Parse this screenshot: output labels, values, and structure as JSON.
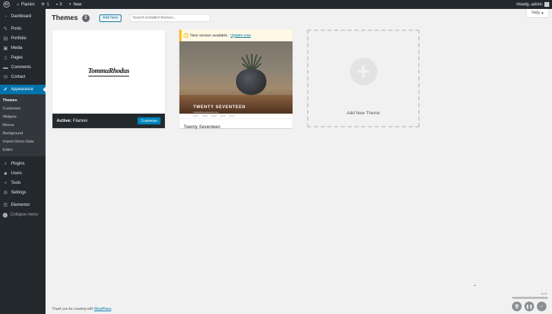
{
  "admin_bar": {
    "site_name": "Flamini",
    "updates_count": "1",
    "comments_count": "0",
    "new_label": "New",
    "howdy": "Howdy, admin"
  },
  "sidebar": {
    "items": [
      {
        "label": "Dashboard",
        "icon": "dashboard-icon"
      },
      {
        "label": "Posts",
        "icon": "pin-icon"
      },
      {
        "label": "Portfolio",
        "icon": "portfolio-icon"
      },
      {
        "label": "Media",
        "icon": "media-icon"
      },
      {
        "label": "Pages",
        "icon": "pages-icon"
      },
      {
        "label": "Comments",
        "icon": "comment-icon"
      },
      {
        "label": "Contact",
        "icon": "mail-icon"
      },
      {
        "label": "Appearance",
        "icon": "paintbrush-icon"
      }
    ],
    "appearance_submenu": [
      "Themes",
      "Customize",
      "Widgets",
      "Menus",
      "Background",
      "Import Demo Data",
      "Editor"
    ],
    "items_after": [
      {
        "label": "Plugins",
        "icon": "plugin-icon"
      },
      {
        "label": "Users",
        "icon": "users-icon"
      },
      {
        "label": "Tools",
        "icon": "wrench-icon"
      },
      {
        "label": "Settings",
        "icon": "settings-icon"
      },
      {
        "label": "Elementor",
        "icon": "elementor-icon"
      }
    ],
    "collapse_label": "Collapse menu"
  },
  "help_tab": {
    "label": "Help"
  },
  "page": {
    "title": "Themes",
    "theme_count": "2",
    "add_new_label": "Add New",
    "search_placeholder": "Search installed themes..."
  },
  "themes": {
    "active": {
      "screenshot_text": "TommuRhodus",
      "active_prefix": "Active:",
      "name": "Flamini",
      "customize_label": "Customize"
    },
    "second": {
      "notice_text": "New version available.",
      "notice_link": "Update now",
      "screenshot_title": "TWENTY SEVENTEEN",
      "screenshot_tagline": "A WordPress theme for you",
      "name": "Twenty Seventeen"
    },
    "add_new": {
      "label": "Add New Theme"
    }
  },
  "footer": {
    "text": "Thank you for creating with",
    "link": "WordPress",
    "suffix": "."
  },
  "recorder": {
    "time": "00:00"
  },
  "colors": {
    "admin_dark": "#23282d",
    "accent": "#0073aa",
    "background": "#f1f1f1",
    "notice": "#ffb900"
  }
}
